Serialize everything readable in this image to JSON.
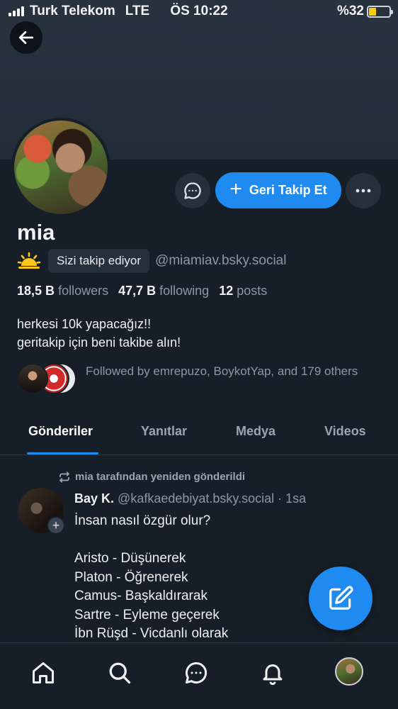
{
  "status_bar": {
    "carrier": "Turk Telekom",
    "network": "LTE",
    "time": "ÖS 10:22",
    "battery_text": "%32",
    "battery_level": 0.32
  },
  "profile": {
    "name": "mia",
    "follows_you_badge": "Sizi takip ediyor",
    "handle": "@miamiav.bsky.social",
    "followers_count": "18,5 B",
    "followers_label": "followers",
    "following_count": "47,7 B",
    "following_label": "following",
    "posts_count": "12",
    "posts_label": "posts",
    "bio_line1": "herkesi 10k yapacağız!!",
    "bio_line2": "geritakip için beni takibe alın!",
    "followed_by": "Followed by emrepuzo, BoykotYap, and 179 others",
    "follow_button_label": "Geri Takip Et"
  },
  "tabs": [
    "Gönderiler",
    "Yanıtlar",
    "Medya",
    "Videos"
  ],
  "active_tab": 0,
  "post": {
    "repost_label": "mia tarafından yeniden gönderildi",
    "author": "Bay K.",
    "author_handle": "@kafkaedebiyat.bsky.social",
    "time_sep": "·",
    "time": "1sa",
    "line1": "İnsan nasıl özgür olur?",
    "line2": "Aristo - Düşünerek",
    "line3": "Platon - Öğrenerek",
    "line4": "Camus- Başkaldırarak",
    "line5": "Sartre - Eyleme geçerek",
    "line6": "İbn Rüşd - Vicdanlı olarak"
  },
  "icons": {
    "back": "arrow-left-icon",
    "message": "chat-bubble-icon",
    "more": "ellipsis-icon",
    "sun": "sunrise-emoji",
    "repost": "repost-icon",
    "compose": "compose-icon",
    "nav_home": "home-icon",
    "nav_search": "search-icon",
    "nav_chat": "chat-icon",
    "nav_notifications": "bell-icon"
  },
  "colors": {
    "background": "#161e27",
    "accent": "#1f8af0",
    "muted_text": "#8d98a5",
    "battery": "#ffcc00"
  }
}
